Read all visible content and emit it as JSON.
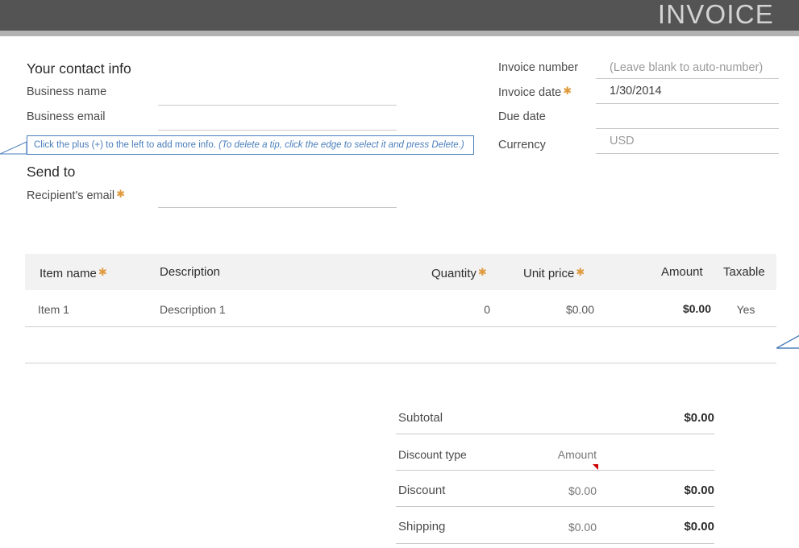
{
  "header": {
    "title": "INVOICE"
  },
  "contact": {
    "section_title": "Your contact info",
    "fields": [
      {
        "label": "Business name",
        "value": "",
        "required": false
      },
      {
        "label": "Business email",
        "value": "",
        "required": false
      }
    ]
  },
  "tip": {
    "text_plain": "Click the plus (+) to the left to add more info. ",
    "text_italic": "(To delete a tip, click the edge to select it and press Delete.)",
    "border_color": "#4a7ebb"
  },
  "send_to": {
    "section_title": "Send to",
    "fields": [
      {
        "label": "Recipient's email",
        "value": "",
        "required": true
      }
    ]
  },
  "invoice_meta": {
    "fields": [
      {
        "label": "Invoice number",
        "value": "(Leave blank to auto-number)",
        "required": false,
        "is_placeholder": true
      },
      {
        "label": "Invoice date",
        "value": "1/30/2014",
        "required": true,
        "is_placeholder": false
      },
      {
        "label": "Due date",
        "value": "",
        "required": false,
        "is_placeholder": false
      },
      {
        "label": "Currency",
        "value": "USD",
        "required": false,
        "is_placeholder": true
      }
    ]
  },
  "items_table": {
    "columns": [
      {
        "label": "Item name",
        "required": true
      },
      {
        "label": "Description",
        "required": false
      },
      {
        "label": "Quantity",
        "required": true
      },
      {
        "label": "Unit price",
        "required": true
      },
      {
        "label": "Amount",
        "required": false
      },
      {
        "label": "Taxable",
        "required": false
      }
    ],
    "rows": [
      {
        "item_name": "Item 1",
        "description": "Description 1",
        "quantity": "0",
        "unit_price": "$0.00",
        "amount": "$0.00",
        "taxable": "Yes"
      }
    ]
  },
  "totals": {
    "subtotal": {
      "label": "Subtotal",
      "amount": "$0.00"
    },
    "discount_type": {
      "label": "Discount type",
      "value": "Amount"
    },
    "discount": {
      "label": "Discount",
      "value": "$0.00",
      "amount": "$0.00"
    },
    "shipping": {
      "label": "Shipping",
      "value": "$0.00",
      "amount": "$0.00"
    }
  },
  "colors": {
    "header_bar": "#545454",
    "header_strip": "#b2b2b2",
    "required_star": "#e09a3e",
    "tip_blue": "#4a7ebb",
    "table_head_bg": "#f2f2f2",
    "comment_marker": "#cc0000"
  }
}
